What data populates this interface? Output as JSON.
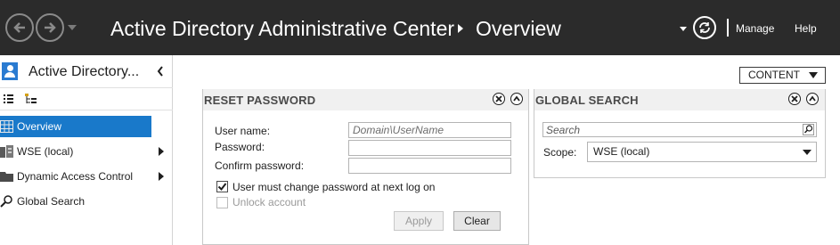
{
  "titlebar": {
    "app_title": "Active Directory Administrative Center",
    "current_page": "Overview",
    "menu": [
      "Manage",
      "Help"
    ]
  },
  "sidebar": {
    "title": "Active Directory...",
    "items": [
      {
        "label": "Overview",
        "selected": true,
        "icon": "grid-icon"
      },
      {
        "label": "WSE (local)",
        "selected": false,
        "icon": "domain-icon",
        "expandable": true
      },
      {
        "label": "Dynamic Access Control",
        "selected": false,
        "icon": "folder-icon",
        "expandable": true
      },
      {
        "label": "Global Search",
        "selected": false,
        "icon": "search-icon"
      }
    ]
  },
  "content_menu": {
    "label": "CONTENT"
  },
  "reset_password": {
    "title": "RESET PASSWORD",
    "username_label": "User name:",
    "username_placeholder": "Domain\\UserName",
    "password_label": "Password:",
    "confirm_label": "Confirm password:",
    "must_change_label": "User must change password at next log on",
    "must_change_checked": true,
    "unlock_label": "Unlock account",
    "unlock_checked": false,
    "apply_label": "Apply",
    "clear_label": "Clear"
  },
  "global_search": {
    "title": "GLOBAL SEARCH",
    "search_placeholder": "Search",
    "scope_label": "Scope:",
    "scope_value": "WSE (local)"
  },
  "colors": {
    "titlebar_bg": "#2b2b2b",
    "selection": "#1979ca",
    "panel_header": "#f0f0f0"
  }
}
